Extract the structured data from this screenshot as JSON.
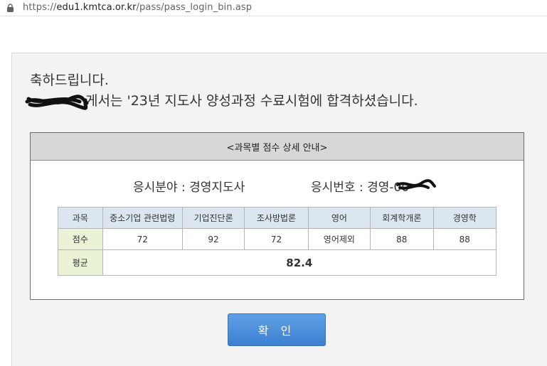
{
  "address_bar": {
    "scheme": "https://",
    "host": "edu1.kmtca.or.kr",
    "path": "/pass/pass_login_bin.asp"
  },
  "message": {
    "greeting": "축하드립니다.",
    "pass_text": "게서는 '23년 지도사 양성과정 수료시험에 합격하셨습니다."
  },
  "details": {
    "title": "<과목별 점수 상세 안내>",
    "field_label": "응시분야 : 경영지도사",
    "exam_number_label": "응시번호 : 경영-00"
  },
  "score_table": {
    "header_label": "과목",
    "subjects": [
      "중소기업 관련법령",
      "기업진단론",
      "조사방법론",
      "영어",
      "회계학개론",
      "경영학"
    ],
    "score_label": "점수",
    "scores": [
      "72",
      "92",
      "72",
      "영어제외",
      "88",
      "88"
    ],
    "average_label": "평균",
    "average": "82.4"
  },
  "confirm_button": {
    "label": "확 인",
    "color": "#4a8ee0"
  },
  "icons": {
    "lock": "lock-icon"
  }
}
